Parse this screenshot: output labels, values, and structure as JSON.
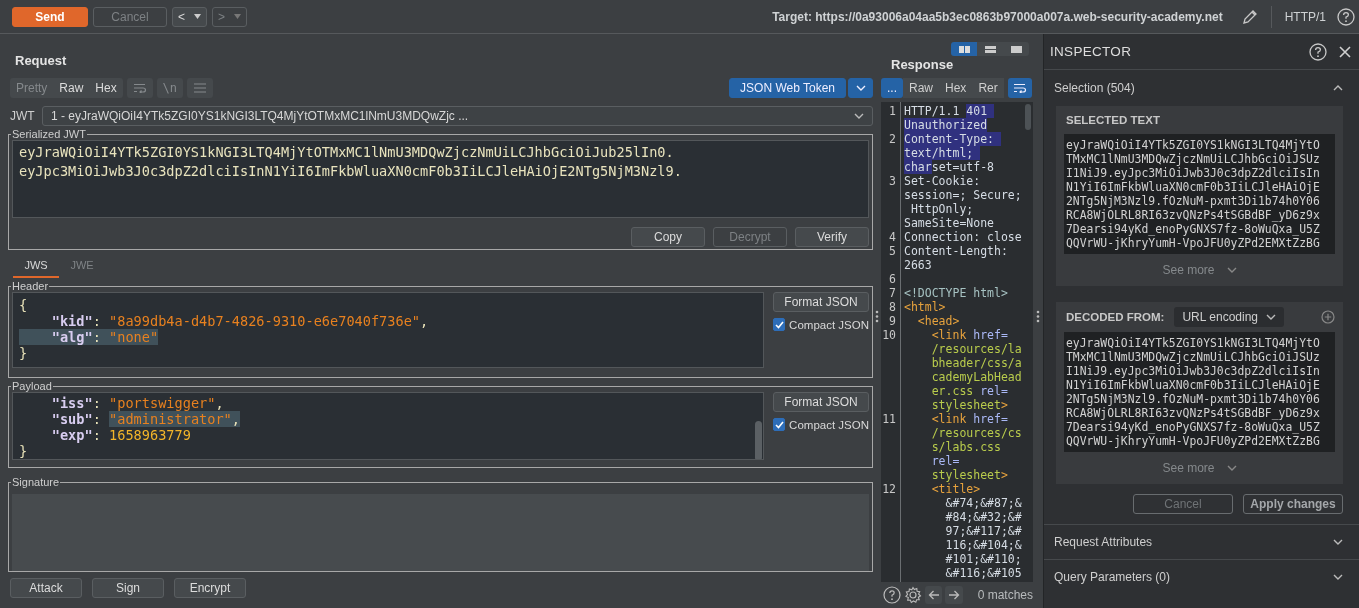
{
  "toolbar": {
    "send": "Send",
    "cancel": {
      "label": "Cancel",
      "disabled": true
    },
    "back": {
      "label": "<",
      "disabled": false
    },
    "forward": {
      "label": ">",
      "disabled": true
    },
    "target": "Target: https://0a93006a04aa5b3ec0863b97000a007a.web-security-academy.net",
    "protocol": "HTTP/1"
  },
  "request": {
    "title": "Request",
    "view_tabs": [
      {
        "label": "Pretty",
        "disabled": true
      },
      {
        "label": "Raw",
        "disabled": false
      },
      {
        "label": "Hex",
        "disabled": false
      }
    ],
    "newline_button": "\\n",
    "editor_button": "JSON Web Token",
    "jwt_label": "JWT",
    "jwt_select": "1 - eyJraWQiOiI4YTk5ZGI0YS1kNGI3LTQ4MjYtOTMxMC1lNmU3MDQwZjc ...",
    "serialized": {
      "legend": "Serialized JWT",
      "lines": [
        "eyJraWQiOiI4YTk5ZGI0YS1kNGI3LTQ4MjYtOTMxMC1lNmU3MDQwZjczNmUiLCJhbGciOiJub25lIn0.",
        "eyJpc3MiOiJwb3J0c3dpZ2dlciIsInN1YiI6ImFkbWluaXN0cmF0b3IiLCJleHAiOjE2NTg5NjM3Nzl9."
      ],
      "buttons": [
        {
          "label": "Copy",
          "disabled": false
        },
        {
          "label": "Decrypt",
          "disabled": true
        },
        {
          "label": "Verify",
          "disabled": false
        }
      ]
    },
    "tabs": [
      {
        "label": "JWS",
        "selected": true
      },
      {
        "label": "JWE",
        "selected": false
      }
    ],
    "sections": [
      {
        "legend": "Header",
        "format_button": "Format JSON",
        "compact": {
          "label": "Compact JSON",
          "checked": true
        },
        "lines": [
          {
            "segments": [
              {
                "text": "{",
                "kind": "punct",
                "selected": false
              }
            ]
          },
          {
            "segments": [
              {
                "text": "    \"kid\"",
                "kind": "key",
                "selected": false
              },
              {
                "text": ": ",
                "kind": "punct",
                "selected": false
              },
              {
                "text": "\"8a99db4a-d4b7-4826-9310-e6e7040f736e\"",
                "kind": "string",
                "selected": false
              },
              {
                "text": ",",
                "kind": "punct",
                "selected": false
              }
            ]
          },
          {
            "segments": [
              {
                "text": "    \"alg\"",
                "kind": "key",
                "selected": true
              },
              {
                "text": ": ",
                "kind": "punct",
                "selected": true
              },
              {
                "text": "\"none\"",
                "kind": "string",
                "selected": true
              }
            ]
          },
          {
            "segments": [
              {
                "text": "}",
                "kind": "punct",
                "selected": false
              }
            ]
          }
        ]
      },
      {
        "legend": "Payload",
        "format_button": "Format JSON",
        "compact": {
          "label": "Compact JSON",
          "checked": true
        },
        "lines": [
          {
            "segments": [
              {
                "text": "    \"iss\"",
                "kind": "key",
                "selected": false
              },
              {
                "text": ": ",
                "kind": "punct",
                "selected": false
              },
              {
                "text": "\"portswigger\"",
                "kind": "string",
                "selected": false
              },
              {
                "text": ",",
                "kind": "punct",
                "selected": false
              }
            ]
          },
          {
            "segments": [
              {
                "text": "    \"sub\"",
                "kind": "key",
                "selected": false
              },
              {
                "text": ": ",
                "kind": "punct",
                "selected": false
              },
              {
                "text": "\"administrator\"",
                "kind": "string",
                "selected": true
              },
              {
                "text": ",",
                "kind": "punct",
                "selected": true
              }
            ]
          },
          {
            "segments": [
              {
                "text": "    \"exp\"",
                "kind": "key",
                "selected": false
              },
              {
                "text": ": ",
                "kind": "punct",
                "selected": false
              },
              {
                "text": "1658963779",
                "kind": "number",
                "selected": false
              }
            ]
          },
          {
            "segments": [
              {
                "text": "}",
                "kind": "punct",
                "selected": false
              }
            ]
          }
        ]
      }
    ],
    "signature": {
      "legend": "Signature"
    },
    "actions": [
      "Attack",
      "Sign",
      "Encrypt"
    ]
  },
  "response": {
    "title": "Response",
    "layout_buttons": [
      {
        "kind": "columns",
        "selected": true
      },
      {
        "kind": "rows",
        "selected": false
      },
      {
        "kind": "single",
        "selected": false
      }
    ],
    "view_tabs": [
      {
        "label": "...",
        "selected": true
      },
      {
        "label": "Raw",
        "selected": false
      },
      {
        "label": "Hex",
        "selected": false
      },
      {
        "label": "Rer",
        "selected": false
      }
    ],
    "wrap_on": true,
    "rows": [
      {
        "number": "1",
        "segments": [
          {
            "text": "HTTP/1.1 ",
            "kind": "plain",
            "selected": false
          },
          {
            "text": "401 ",
            "kind": "plain",
            "selected": true
          }
        ]
      },
      {
        "segments": [
          {
            "text": "Unauthorized",
            "kind": "plain",
            "selected": true
          }
        ]
      },
      {
        "number": "2",
        "segments": [
          {
            "text": "Content-Type: ",
            "kind": "plain",
            "selected": true
          }
        ]
      },
      {
        "segments": [
          {
            "text": "text/html; ",
            "kind": "plain",
            "selected": true
          }
        ]
      },
      {
        "segments": [
          {
            "text": "char",
            "kind": "plain",
            "selected": true
          },
          {
            "text": "set=utf-8",
            "kind": "plain",
            "selected": false
          }
        ]
      },
      {
        "number": "3",
        "segments": [
          {
            "text": "Set-Cookie:",
            "kind": "plain",
            "selected": false
          }
        ]
      },
      {
        "segments": [
          {
            "text": "session=; Secure;",
            "kind": "plain",
            "selected": false
          }
        ]
      },
      {
        "segments": [
          {
            "text": " HttpOnly;",
            "kind": "plain",
            "selected": false
          }
        ]
      },
      {
        "segments": [
          {
            "text": "SameSite=None",
            "kind": "plain",
            "selected": false
          }
        ]
      },
      {
        "number": "4",
        "segments": [
          {
            "text": "Connection: close",
            "kind": "plain",
            "selected": false
          }
        ]
      },
      {
        "number": "5",
        "segments": [
          {
            "text": "Content-Length:",
            "kind": "plain",
            "selected": false
          }
        ]
      },
      {
        "segments": [
          {
            "text": "2663",
            "kind": "plain",
            "selected": false
          }
        ]
      },
      {
        "number": "6"
      },
      {
        "number": "7",
        "segments": [
          {
            "text": "<!DOCTYPE html>",
            "kind": "doctype",
            "selected": false
          }
        ]
      },
      {
        "number": "8",
        "segments": [
          {
            "text": "<html>",
            "kind": "tag",
            "selected": false
          }
        ]
      },
      {
        "number": "9",
        "segments": [
          {
            "text": "  <head>",
            "kind": "tag",
            "selected": false
          }
        ]
      },
      {
        "number": "10",
        "segments": [
          {
            "text": "    <link ",
            "kind": "tag",
            "selected": false
          },
          {
            "text": "href=",
            "kind": "attr",
            "selected": false
          }
        ]
      },
      {
        "segments": [
          {
            "text": "    /resources/la",
            "kind": "value",
            "selected": false
          }
        ]
      },
      {
        "segments": [
          {
            "text": "    bheader/css/a",
            "kind": "value",
            "selected": false
          }
        ]
      },
      {
        "segments": [
          {
            "text": "    cademyLabHead",
            "kind": "value",
            "selected": false
          }
        ]
      },
      {
        "segments": [
          {
            "text": "    er.css ",
            "kind": "value",
            "selected": false
          },
          {
            "text": "rel=",
            "kind": "attr",
            "selected": false
          }
        ]
      },
      {
        "segments": [
          {
            "text": "    stylesheet",
            "kind": "value",
            "selected": false
          },
          {
            "text": ">",
            "kind": "tag",
            "selected": false
          }
        ]
      },
      {
        "number": "11",
        "segments": [
          {
            "text": "    <link ",
            "kind": "tag",
            "selected": false
          },
          {
            "text": "href=",
            "kind": "attr",
            "selected": false
          }
        ]
      },
      {
        "segments": [
          {
            "text": "    /resources/cs",
            "kind": "value",
            "selected": false
          }
        ]
      },
      {
        "segments": [
          {
            "text": "    s/labs.css",
            "kind": "value",
            "selected": false
          }
        ]
      },
      {
        "segments": [
          {
            "text": "    rel=",
            "kind": "attr",
            "selected": false
          }
        ]
      },
      {
        "segments": [
          {
            "text": "    stylesheet",
            "kind": "value",
            "selected": false
          },
          {
            "text": ">",
            "kind": "tag",
            "selected": false
          }
        ]
      },
      {
        "number": "12",
        "segments": [
          {
            "text": "    <title>",
            "kind": "tag",
            "selected": false
          }
        ]
      },
      {
        "segments": [
          {
            "text": "      &#74;&#87;&",
            "kind": "plain",
            "selected": false
          }
        ]
      },
      {
        "segments": [
          {
            "text": "      #84;&#32;&#",
            "kind": "plain",
            "selected": false
          }
        ]
      },
      {
        "segments": [
          {
            "text": "      97;&#117;&#",
            "kind": "plain",
            "selected": false
          }
        ]
      },
      {
        "segments": [
          {
            "text": "      116;&#104;&",
            "kind": "plain",
            "selected": false
          }
        ]
      },
      {
        "segments": [
          {
            "text": "      #101;&#110;",
            "kind": "plain",
            "selected": false
          }
        ]
      },
      {
        "segments": [
          {
            "text": "      &#116;&#105",
            "kind": "plain",
            "selected": false
          }
        ]
      }
    ],
    "matches": "0 matches"
  },
  "inspector": {
    "title": "INSPECTOR",
    "selection": "Selection (504)",
    "selected_text": {
      "title": "SELECTED TEXT",
      "lines": [
        "eyJraWQiOiI4YTk5ZGI0YS1kNGI3LTQ4MjYtO",
        "TMxMC1lNmU3MDQwZjczNmUiLCJhbGciOiJSUz",
        "I1NiJ9.eyJpc3MiOiJwb3J0c3dpZ2dlciIsIn",
        "N1YiI6ImFkbWluaXN0cmF0b3IiLCJleHAiOjE",
        "2NTg5NjM3Nzl9.fOzNuM-pxmt3Di1b74h0Y06",
        "RCA8WjOLRL8RI63zvQNzPs4tSGBdBF_yD6z9x",
        "7Dearsi94yKd_enoPyGNXS7fz-8oWuQxa_U5Z",
        "QQVrWU-jKhryYumH-VpoJFU0yZPd2EMXtZzBG"
      ],
      "see_more": "See more"
    },
    "decoded": {
      "title": "DECODED FROM:",
      "encoding": "URL encoding",
      "lines": [
        "eyJraWQiOiI4YTk5ZGI0YS1kNGI3LTQ4MjYtO",
        "TMxMC1lNmU3MDQwZjczNmUiLCJhbGciOiJSUz",
        "I1NiJ9.eyJpc3MiOiJwb3J0c3dpZ2dlciIsIn",
        "N1YiI6ImFkbWluaXN0cmF0b3IiLCJleHAiOjE",
        "2NTg5NjM3Nzl9.fOzNuM-pxmt3Di1b74h0Y06",
        "RCA8WjOLRL8RI63zvQNzPs4tSGBdBF_yD6z9x",
        "7Dearsi94yKd_enoPyGNXS7fz-8oWuQxa_U5Z",
        "QQVrWU-jKhryYumH-VpoJFU0yZPd2EMXtZzBG"
      ],
      "see_more": "See more"
    },
    "buttons": [
      {
        "label": "Cancel",
        "disabled": true
      },
      {
        "label": "Apply changes",
        "disabled": false
      }
    ],
    "sections": [
      {
        "label": "Request Attributes",
        "expanded": false
      },
      {
        "label": "Query Parameters (0)",
        "expanded": false
      }
    ]
  }
}
